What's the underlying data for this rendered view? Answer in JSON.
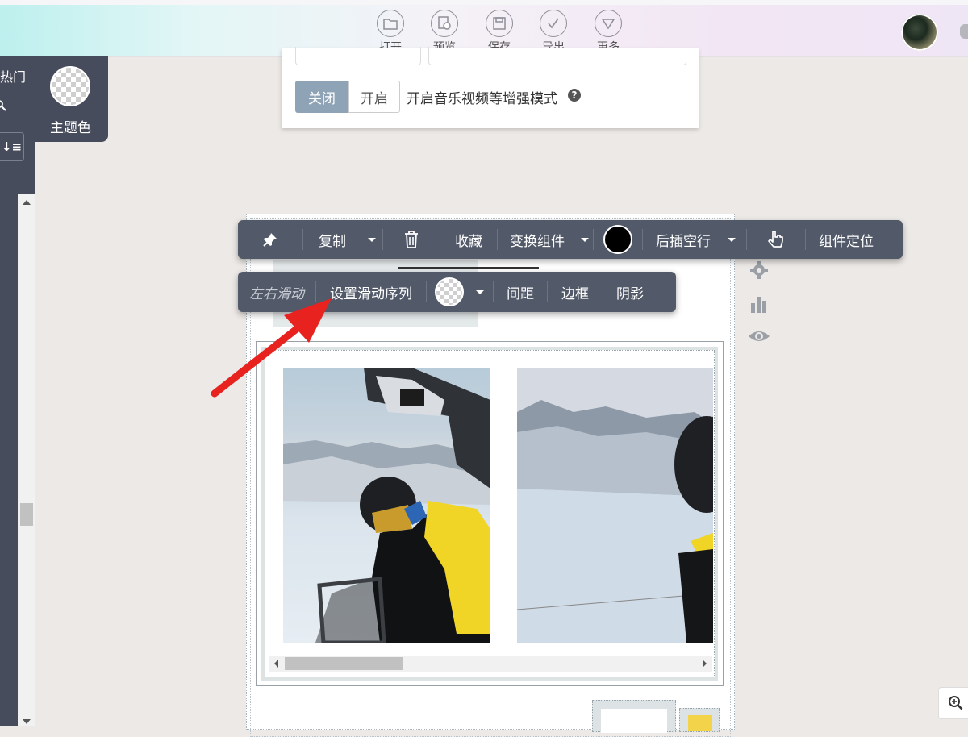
{
  "top_toolbar": {
    "open": "打开",
    "preview": "预览",
    "save": "保存",
    "export": "导出",
    "more": "更多"
  },
  "sidebar": {
    "hot_label": "热门",
    "theme_color_label": "主题色"
  },
  "settings_card": {
    "toggle_off": "关闭",
    "toggle_on": "开启",
    "toggle_selected": "关闭",
    "enhanced_mode_label": "开启音乐视频等增强模式"
  },
  "component_toolbar": {
    "pin_icon": "pin-icon",
    "copy": "复制",
    "delete_icon": "trash-icon",
    "favorite": "收藏",
    "transform": "变换组件",
    "color_swatch": "#000000",
    "insert_empty_row": "后插空行",
    "pointer_icon": "hand-pointer-icon",
    "locate": "组件定位"
  },
  "slide_toolbar": {
    "mode_label": "左右滑动",
    "set_sequence": "设置滑动序列",
    "spacing": "间距",
    "border": "边框",
    "shadow": "阴影"
  },
  "canvas": {
    "slider_images": [
      "skier-photo-1",
      "skier-photo-2"
    ]
  },
  "colors": {
    "toolbar_bg": "#525969",
    "sidebar_bg": "#474c5c",
    "toggle_active_bg": "#8fa3b6",
    "annotation_arrow": "#e8231f"
  }
}
